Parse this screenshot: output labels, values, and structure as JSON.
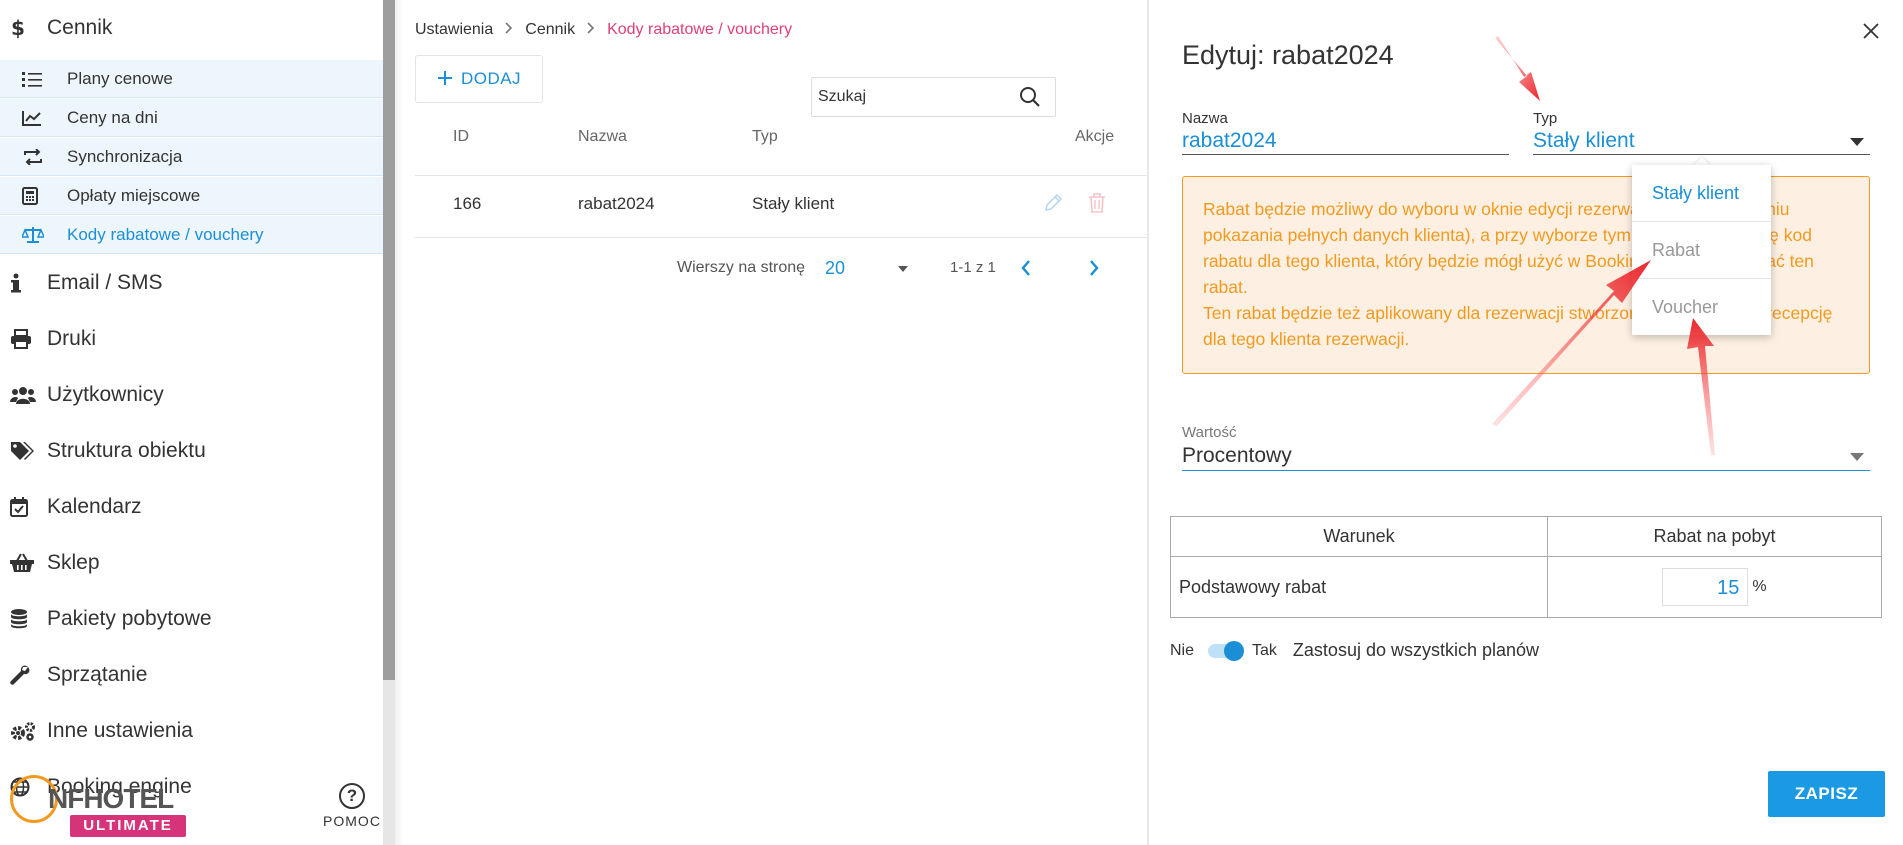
{
  "sidebar": {
    "section_title": "Cennik",
    "sub_items": [
      {
        "label": "Plany cenowe",
        "icon": "list-icon"
      },
      {
        "label": "Ceny na dni",
        "icon": "chart-line-icon"
      },
      {
        "label": "Synchronizacja",
        "icon": "sync-icon"
      },
      {
        "label": "Opłaty miejscowe",
        "icon": "calculator-icon"
      },
      {
        "label": "Kody rabatowe / vouchery",
        "icon": "scale-icon",
        "active": true
      }
    ],
    "items": [
      {
        "label": "Email / SMS",
        "icon": "info-icon"
      },
      {
        "label": "Druki",
        "icon": "printer-icon"
      },
      {
        "label": "Użytkownicy",
        "icon": "users-icon"
      },
      {
        "label": "Struktura obiektu",
        "icon": "tags-icon"
      },
      {
        "label": "Kalendarz",
        "icon": "calendar-check-icon"
      },
      {
        "label": "Sklep",
        "icon": "basket-icon"
      },
      {
        "label": "Pakiety pobytowe",
        "icon": "database-icon"
      },
      {
        "label": "Sprzątanie",
        "icon": "wrench-icon"
      },
      {
        "label": "Inne ustawienia",
        "icon": "gears-icon"
      },
      {
        "label": "Booking engine",
        "icon": "globe-icon"
      }
    ],
    "logo_text": "NFHOTEL",
    "logo_badge": "ULTIMATE",
    "help_label": "POMOC"
  },
  "breadcrumb": [
    "Ustawienia",
    "Cennik",
    "Kody rabatowe / vouchery"
  ],
  "toolbar": {
    "add_label": "DODAJ"
  },
  "search": {
    "placeholder": "Szukaj",
    "value": ""
  },
  "table": {
    "headers": {
      "id": "ID",
      "name": "Nazwa",
      "type": "Typ",
      "actions": "Akcje"
    },
    "rows": [
      {
        "id": "166",
        "name": "rabat2024",
        "type": "Stały klient"
      }
    ]
  },
  "pagination": {
    "rows_per_page_label": "Wierszy na stronę",
    "rows_per_page": "20",
    "range": "1-1 z 1"
  },
  "edit": {
    "title": "Edytuj: rabat2024",
    "name_label": "Nazwa",
    "name_value": "rabat2024",
    "type_label": "Typ",
    "type_value": "Stały klient",
    "alert_text": "Rabat będzie możliwy do wyboru w oknie edycji rezerwacji (po przełączeniu pokazania pełnych danych klienta), a przy wyborze tym rabatu, pokaże się kod rabatu dla tego klienta, który będzie mógł użyć w Booking Engine i uzyskać ten rabat.\nTen rabat będzie też aplikowany dla rezerwacji stworzonej ręcznie przez recepcję dla tego klienta rezerwacji.",
    "value_label": "Wartość",
    "value_value": "Procentowy",
    "cond_table": {
      "header_condition": "Warunek",
      "header_discount": "Rabat na pobyt",
      "row_label": "Podstawowy rabat",
      "row_value": "15",
      "unit": "%"
    },
    "toggle": {
      "off_label": "Nie",
      "on_label": "Tak",
      "description": "Zastosuj do wszystkich planów",
      "on": true
    },
    "save_label": "ZAPISZ"
  },
  "dropdown": {
    "options": [
      {
        "label": "Stały klient",
        "state": "selected"
      },
      {
        "label": "Rabat",
        "state": "disabled"
      },
      {
        "label": "Voucher",
        "state": "disabled"
      }
    ]
  },
  "colors": {
    "accent": "#1b8fd6",
    "breadcrumb_active": "#e0407a",
    "alert": "#f29a1f",
    "alert_bg": "#fdf0e2",
    "arrow": "#e8262b"
  }
}
